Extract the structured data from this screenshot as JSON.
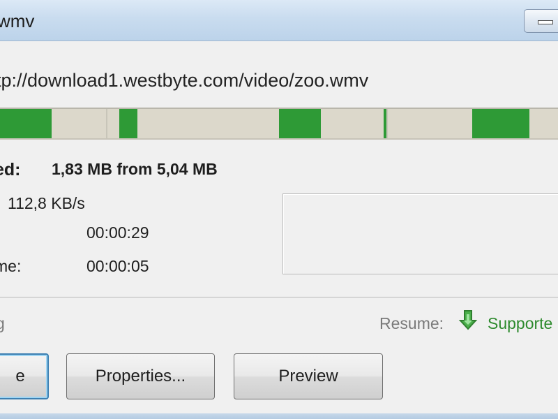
{
  "window": {
    "title": "wmv"
  },
  "download": {
    "url": "tp://download1.westbyte.com/video/zoo.wmv",
    "progress": {
      "downloaded_mb": 1.83,
      "total_mb": 5.04,
      "filled_segments_fraction": [
        [
          0.0,
          0.095
        ],
        [
          0.215,
          0.248
        ],
        [
          0.5,
          0.575
        ],
        [
          0.687,
          0.692
        ],
        [
          0.845,
          0.946
        ]
      ]
    },
    "downloaded_label": "ed:",
    "downloaded_value": "1,83 MB from 5,04 MB",
    "speed_value": "112,8 KB/s",
    "time_value_1": "00:00:29",
    "time_label_2": "me:",
    "time_value_2": "00:00:05"
  },
  "status": {
    "text": "g",
    "resume_label": "Resume:",
    "resume_value": "Supporte",
    "resume_icon": "green-arrow-down-icon",
    "supported_color": "#2d8a2d"
  },
  "buttons": {
    "first_label": "e",
    "properties_label": "Properties...",
    "preview_label": "Preview"
  },
  "colors": {
    "progress_fill": "#2e9a36",
    "progress_track": "#dcd8cb",
    "default_button_border": "#3c7fb1"
  }
}
